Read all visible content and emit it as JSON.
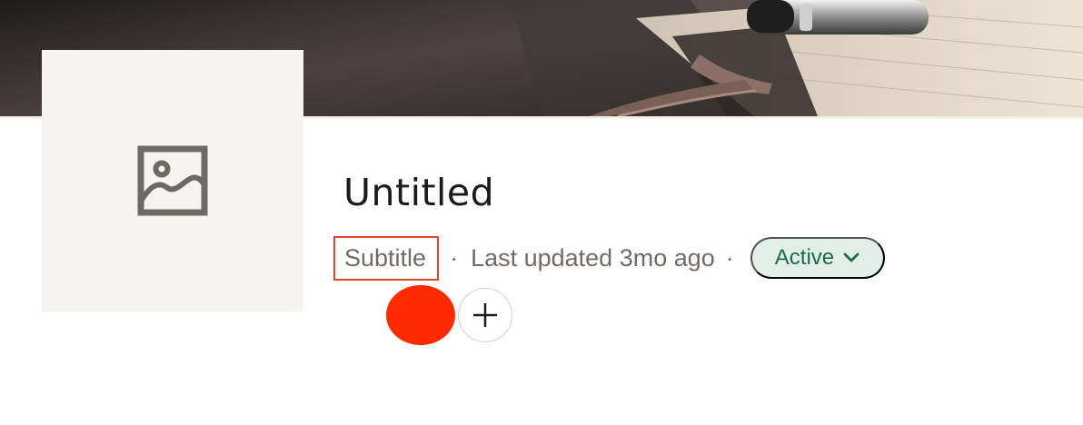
{
  "page": {
    "title": "Untitled",
    "subtitle": "Subtitle",
    "separator": "·",
    "last_updated": "Last updated 3mo ago",
    "status": {
      "label": "Active",
      "icon": "chevron-down-icon",
      "color": "#1d6a4a",
      "background": "#e2efe9"
    }
  },
  "cover": {
    "icon": "cover-photo-notebook-pen"
  },
  "thumbnail": {
    "icon": "image-placeholder-icon"
  },
  "collaborators": {
    "avatar_color": "#ff2a00",
    "add_icon": "plus-icon"
  },
  "colors": {
    "highlight_border": "#e2452b"
  }
}
